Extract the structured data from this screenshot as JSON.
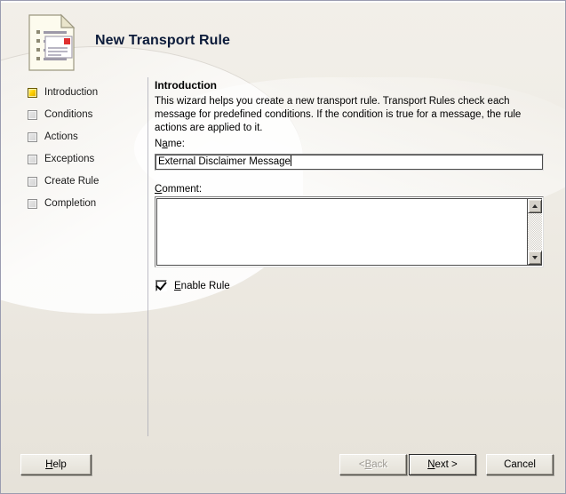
{
  "window": {
    "title": "New Transport Rule",
    "icon": "transport-rule-document-icon",
    "accent_active": "#ffd000",
    "background": "#eae6de",
    "divider_color": "#a8a8b4"
  },
  "sidebar": {
    "items": [
      {
        "label": "Introduction",
        "icon": "step-marker-icon",
        "active": true
      },
      {
        "label": "Conditions",
        "icon": "step-marker-icon",
        "active": false
      },
      {
        "label": "Actions",
        "icon": "step-marker-icon",
        "active": false
      },
      {
        "label": "Exceptions",
        "icon": "step-marker-icon",
        "active": false
      },
      {
        "label": "Create Rule",
        "icon": "step-marker-icon",
        "active": false
      },
      {
        "label": "Completion",
        "icon": "step-marker-icon",
        "active": false
      }
    ]
  },
  "content": {
    "heading": "Introduction",
    "body": "This wizard helps you create a new transport rule. Transport Rules check each message for predefined conditions. If the condition is true for a message, the rule actions are applied to it.",
    "name_field": {
      "label_before": "N",
      "label_accel": "a",
      "label_after": "me:",
      "value": "External Disclaimer Message",
      "placeholder": ""
    },
    "comment_field": {
      "label_accel": "C",
      "label_after": "omment:",
      "value": "",
      "placeholder": ""
    },
    "enable_rule": {
      "label_accel": "E",
      "label_after": "nable Rule",
      "checked": true
    }
  },
  "footer": {
    "help": {
      "accel": "H",
      "after": "elp"
    },
    "back": {
      "before": "< ",
      "accel": "B",
      "after": "ack",
      "disabled": true
    },
    "next": {
      "accel": "N",
      "after": "ext >",
      "is_default": true
    },
    "cancel": {
      "label": "Cancel"
    }
  }
}
